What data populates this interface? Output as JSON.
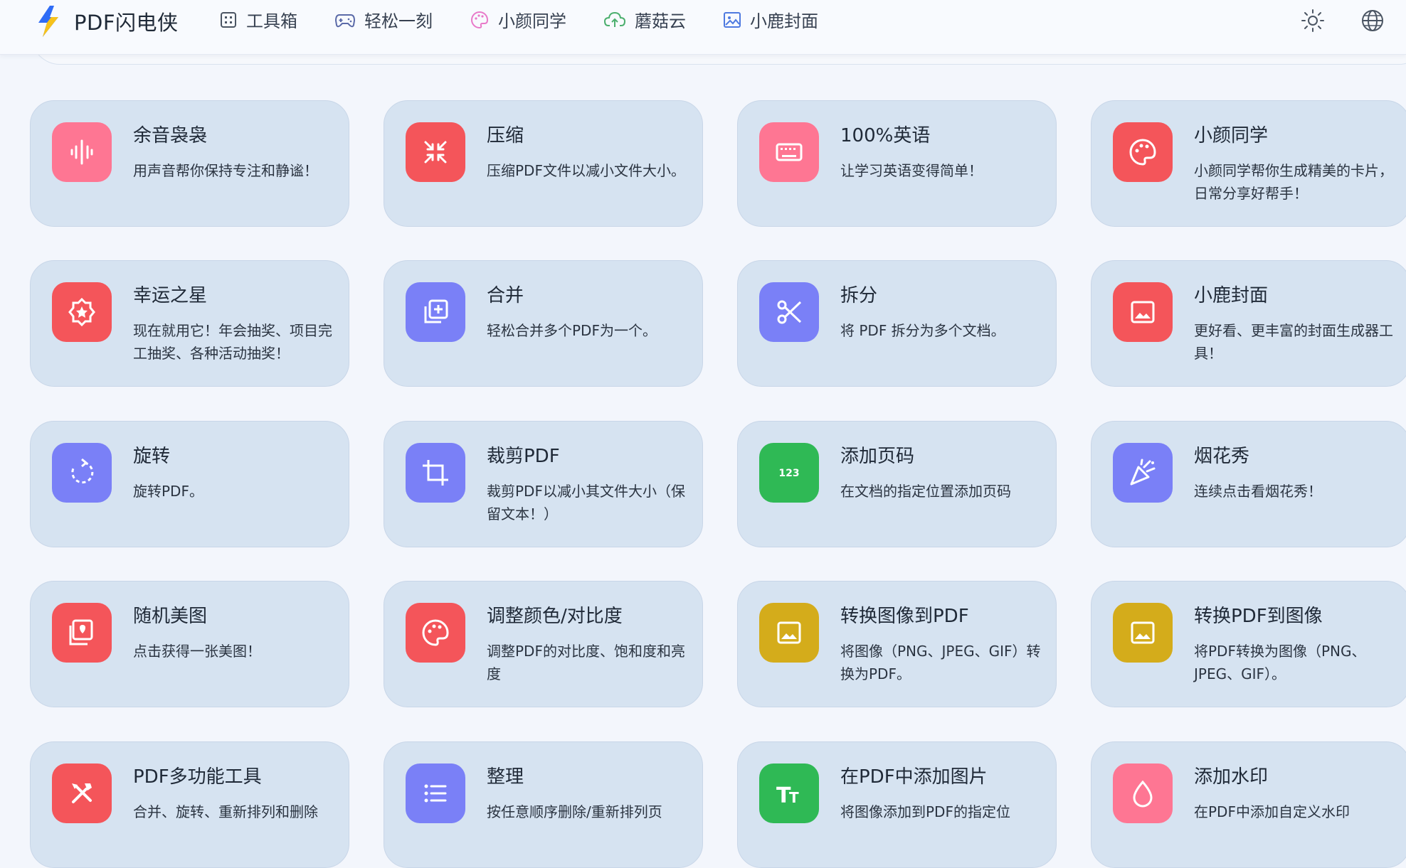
{
  "header": {
    "app_name": "PDF闪电侠",
    "nav": [
      {
        "label": "工具箱",
        "icon": "grid-icon"
      },
      {
        "label": "轻松一刻",
        "icon": "gamepad-icon"
      },
      {
        "label": "小颜同学",
        "icon": "palette-icon"
      },
      {
        "label": "蘑菇云",
        "icon": "cloud-upload-icon"
      },
      {
        "label": "小鹿封面",
        "icon": "image-icon"
      }
    ],
    "right_icons": [
      "sun-icon",
      "globe-icon"
    ]
  },
  "colors": {
    "pink": "#fe7693",
    "red": "#f4555a",
    "indigo": "#7a80f7",
    "green": "#2fb955",
    "gold": "#d4ac1b",
    "card_bg": "#d6e3f1",
    "page_bg": "#f3f6fc"
  },
  "tools": [
    {
      "title": "余音袅袅",
      "desc": "用声音帮你保持专注和静谧！",
      "icon": "sound-wave-icon",
      "color": "#fe7693"
    },
    {
      "title": "压缩",
      "desc": "压缩PDF文件以减小文件大小。",
      "icon": "compress-icon",
      "color": "#f4555a"
    },
    {
      "title": "100%英语",
      "desc": "让学习英语变得简单！",
      "icon": "keyboard-icon",
      "color": "#fe7693"
    },
    {
      "title": "小颜同学",
      "desc": "小颜同学帮你生成精美的卡片，日常分享好帮手！",
      "icon": "palette-icon",
      "color": "#f4555a"
    },
    {
      "title": "幸运之星",
      "desc": "现在就用它！年会抽奖、项目完工抽奖、各种活动抽奖！",
      "icon": "star-badge-icon",
      "color": "#f4555a"
    },
    {
      "title": "合并",
      "desc": "轻松合并多个PDF为一个。",
      "icon": "merge-icon",
      "color": "#7a80f7"
    },
    {
      "title": "拆分",
      "desc": "将 PDF 拆分为多个文档。",
      "icon": "scissors-icon",
      "color": "#7a80f7"
    },
    {
      "title": "小鹿封面",
      "desc": "更好看、更丰富的封面生成器工具！",
      "icon": "image-icon",
      "color": "#f4555a"
    },
    {
      "title": "旋转",
      "desc": "旋转PDF。",
      "icon": "rotate-icon",
      "color": "#7a80f7"
    },
    {
      "title": "裁剪PDF",
      "desc": "裁剪PDF以减小其文件大小（保留文本！）",
      "icon": "crop-icon",
      "color": "#7a80f7"
    },
    {
      "title": "添加页码",
      "desc": "在文档的指定位置添加页码",
      "icon": "numbers-icon",
      "color": "#2fb955"
    },
    {
      "title": "烟花秀",
      "desc": "连续点击看烟花秀！",
      "icon": "party-popper-icon",
      "color": "#7a80f7"
    },
    {
      "title": "随机美图",
      "desc": "点击获得一张美图！",
      "icon": "image-stack-icon",
      "color": "#f4555a"
    },
    {
      "title": "调整颜色/对比度",
      "desc": "调整PDF的对比度、饱和度和亮度",
      "icon": "palette-icon",
      "color": "#f4555a"
    },
    {
      "title": "转换图像到PDF",
      "desc": "将图像（PNG、JPEG、GIF）转换为PDF。",
      "icon": "image-icon",
      "color": "#d4ac1b"
    },
    {
      "title": "转换PDF到图像",
      "desc": "将PDF转换为图像（PNG、JPEG、GIF）。",
      "icon": "image-icon",
      "color": "#d4ac1b"
    },
    {
      "title": "PDF多功能工具",
      "desc": "合并、旋转、重新排列和删除",
      "icon": "tools-icon",
      "color": "#f4555a"
    },
    {
      "title": "整理",
      "desc": "按任意顺序删除/重新排列页",
      "icon": "list-icon",
      "color": "#7a80f7"
    },
    {
      "title": "在PDF中添加图片",
      "desc": "将图像添加到PDF的指定位",
      "icon": "text-size-icon",
      "color": "#2fb955"
    },
    {
      "title": "添加水印",
      "desc": "在PDF中添加自定义水印",
      "icon": "droplet-icon",
      "color": "#fe7693"
    }
  ]
}
